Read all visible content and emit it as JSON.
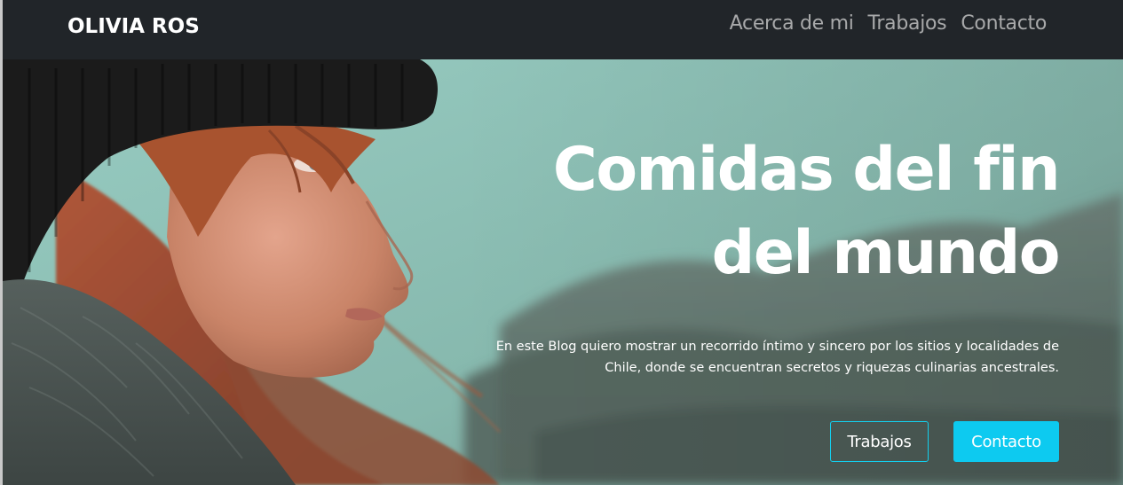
{
  "navbar": {
    "brand": "OLIVIA ROS",
    "links": [
      {
        "label": "Acerca de mi"
      },
      {
        "label": "Trabajos"
      },
      {
        "label": "Contacto"
      }
    ]
  },
  "hero": {
    "title": "Comidas del fin del mundo",
    "description": "En este Blog quiero mostrar un recorrido íntimo y sincero por los sitios y localidades de Chile, donde se encuentran secretos y riquezas culinarias ancestrales.",
    "buttons": {
      "primary_outline": "Trabajos",
      "primary_solid": "Contacto"
    },
    "image_description_icon": "portrait-photo"
  },
  "colors": {
    "navbar_bg": "#212529",
    "nav_link": "#a8a9aa",
    "accent": "#0dcaf0"
  }
}
